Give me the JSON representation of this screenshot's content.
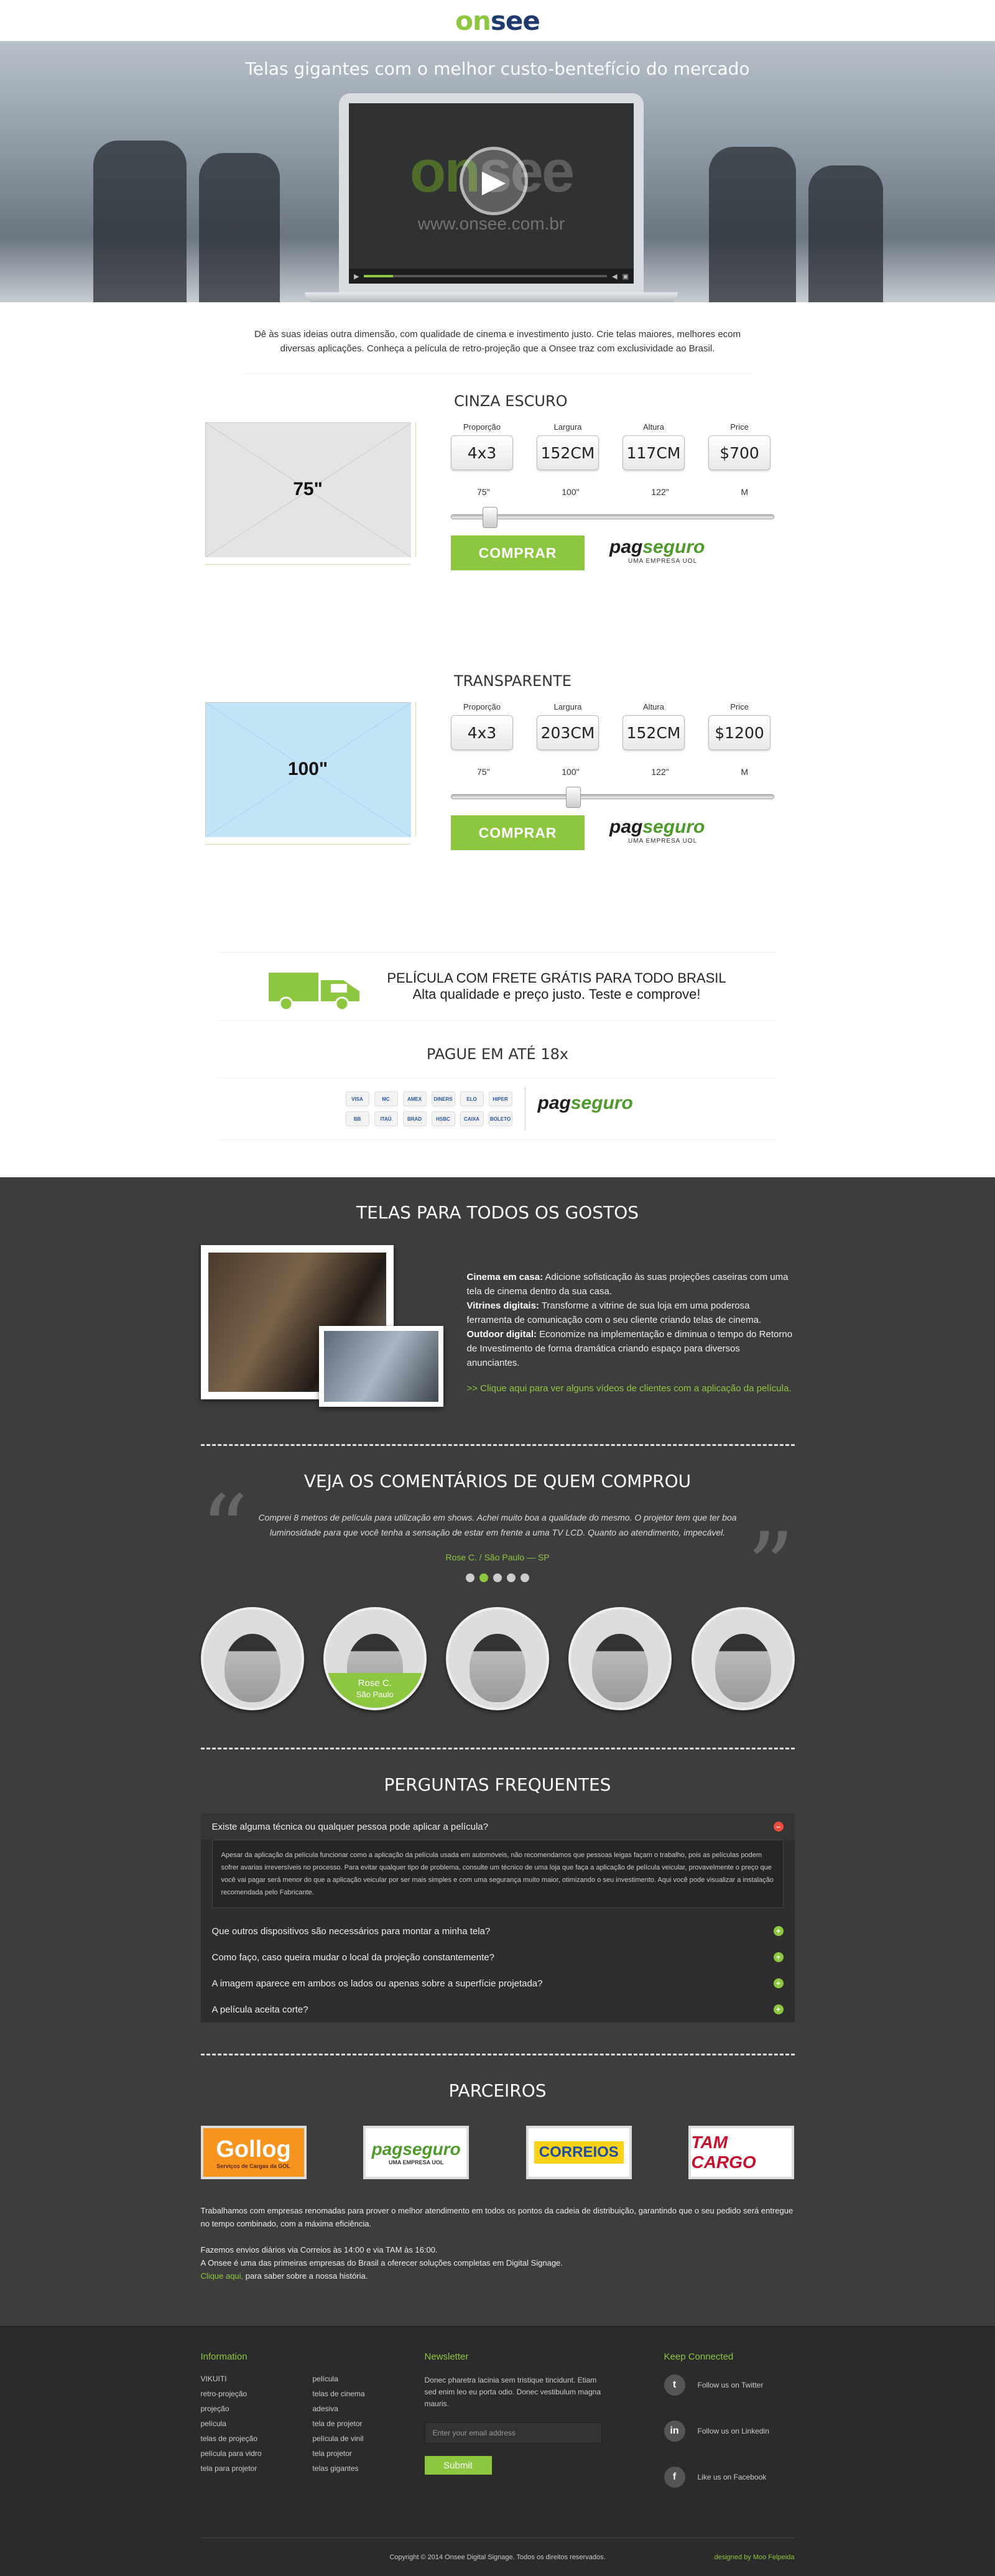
{
  "brand": {
    "logo_on": "on",
    "logo_see": "see"
  },
  "hero": {
    "title": "Telas gigantes com o melhor custo-bentefício do mercado",
    "video_logo_on": "on",
    "video_logo_see": "see",
    "video_url": "www.onsee.com.br"
  },
  "intro": "Dê às suas ideias outra dimensão, com qualidade de cinema e investimento justo. Crie telas maiores, melhores ecom diversas aplicações. Conheça a película de retro-projeção que a Onsee traz com exclusividade ao Brasil.",
  "spec_labels": {
    "ratio": "Proporção",
    "width": "Largura",
    "height": "Altura",
    "price": "Price"
  },
  "slider_ticks": [
    "75\"",
    "100\"",
    "122\"",
    "M"
  ],
  "buy_label": "COMPRAR",
  "pagseguro": {
    "name_a": "pag",
    "name_b": "seguro",
    "sub": "UMA EMPRESA UOL"
  },
  "products": [
    {
      "title": "CINZA ESCURO",
      "size": "75\"",
      "ratio": "4x3",
      "width": "152CM",
      "height": "117CM",
      "price": "$700",
      "slider_pos": 0.1,
      "fill": "#e4e4e4",
      "stroke": "#c9c9c9"
    },
    {
      "title": "TRANSPARENTE",
      "size": "100\"",
      "ratio": "4x3",
      "width": "203CM",
      "height": "152CM",
      "price": "$1200",
      "slider_pos": 0.37,
      "fill": "#c3e3f7",
      "stroke": "#a8d3ee"
    }
  ],
  "freeship": {
    "line1": "PELÍCULA COM FRETE GRÁTIS PARA TODO BRASIL",
    "line2": "Alta qualidade e preço justo. Teste e comprove!"
  },
  "payment": {
    "title": "PAGUE EM ATÉ 18x",
    "cards": [
      "VISA",
      "MC",
      "AMEX",
      "DINERS",
      "ELO",
      "HIPER",
      "BB",
      "ITAÚ",
      "BRAD",
      "HSBC",
      "CAIXA",
      "BOLETO"
    ]
  },
  "gallery": {
    "title": "TELAS PARA TODOS OS GOSTOS",
    "items": [
      {
        "label": "Cinema em casa:",
        "text": " Adicione sofisticação às suas projeções caseiras com uma tela de cinema dentro da sua casa."
      },
      {
        "label": "Vitrines digitais:",
        "text": " Transforme a vitrine de sua loja em uma poderosa ferramenta de comunicação com o seu cliente criando telas de cinema."
      },
      {
        "label": "Outdoor digital:",
        "text": " Economize na implementação e diminua o tempo do Retorno de Investimento de forma dramática criando espaço para diversos anunciantes."
      }
    ],
    "link": ">> Clique aqui para ver alguns vídeos de clientes com a aplicação da película."
  },
  "testimonials": {
    "title": "VEJA OS COMENTÁRIOS DE QUEM COMPROU",
    "quote": "Comprei 8 metros de película para utilização em shows. Achei muito boa a qualidade do mesmo. O projetor tem que ter boa luminosidade para que você tenha a sensação de estar em frente a uma TV LCD. Quanto ao atendimento, impecável.",
    "author": "Rose C. / São Paulo — SP",
    "active_name": "Rose C.",
    "active_city": "São Paulo"
  },
  "faq": {
    "title": "PERGUNTAS FREQUENTES",
    "open_q": "Existe alguma técnica ou qualquer pessoa pode aplicar a película?",
    "open_a": "Apesar da aplicação da película funcionar como a aplicação da película usada em automóveis, não recomendamos que pessoas leigas façam o trabalho, pois as películas podem sofrer avarias irreversíveis no processo. Para evitar qualquer tipo de problema, consulte um técnico de uma loja que faça a aplicação de película veicular, provavelmente o preço que você vai pagar será menor do que a aplicação veicular por ser mais simples e com uma segurança muito maior, otimizando o seu investimento. Aqui você pode visualizar a instalação recomendada pelo Fabricante.",
    "items": [
      "Que outros dispositivos são necessários para montar a minha tela?",
      "Como faço, caso queira mudar o local da projeção constantemente?",
      "A imagem aparece em ambos os lados ou apenas sobre a superfície projetada?",
      "A película aceita corte?"
    ]
  },
  "partners": {
    "title": "PARCEIROS",
    "logos": [
      {
        "name": "Gollog",
        "sub": "Serviços de Cargas da GOL"
      },
      {
        "name": "pagseguro",
        "sub": "UMA EMPRESA UOL"
      },
      {
        "name": "CORREIOS",
        "sub": ""
      },
      {
        "name": "TAM CARGO",
        "sub": ""
      }
    ],
    "p1": "Trabalhamos com empresas renomadas para prover o melhor atendimento em todos os pontos da cadeia de distribuição, garantindo que o seu pedido será entregue no tempo combinado, com a máxima eficiência.",
    "p2": "Fazemos envios diários via Correios às 14:00 e via TAM às 16:00.",
    "p3": "A Onsee é uma das primeiras empresas do Brasil a oferecer soluções completas em Digital Signage.",
    "p4_link": "Clique aqui,",
    "p4_text": " para saber sobre a nossa história."
  },
  "footer": {
    "info_title": "Information",
    "links": [
      "VIKUITI",
      "película",
      "retro-projeção",
      "telas de cinema",
      "projeção",
      "adesiva",
      "película",
      "tela de projetor",
      "telas de projeção",
      "película de vinil",
      "película para vidro",
      "tela projetor",
      "tela para projetor",
      "telas gigantes"
    ],
    "news_title": "Newsletter",
    "news_text": "Donec pharetra lacinia sem tristique tincidunt. Etiam sed enim leo eu porta odio. Donec vestibulum magna mauris.",
    "email_placeholder": "Enter your email address",
    "submit": "Submit",
    "keep_title": "Keep Connected",
    "social": [
      {
        "icon": "t",
        "label": "Follow us on Twitter"
      },
      {
        "icon": "in",
        "label": "Follow us on Linkedin"
      },
      {
        "icon": "f",
        "label": "Like us on Facebook"
      }
    ],
    "copyright": "Copyright © 2014 Onsee Digital Signage. Todos os direitos reservados.",
    "designed": "designed by Moo Felpeida"
  }
}
